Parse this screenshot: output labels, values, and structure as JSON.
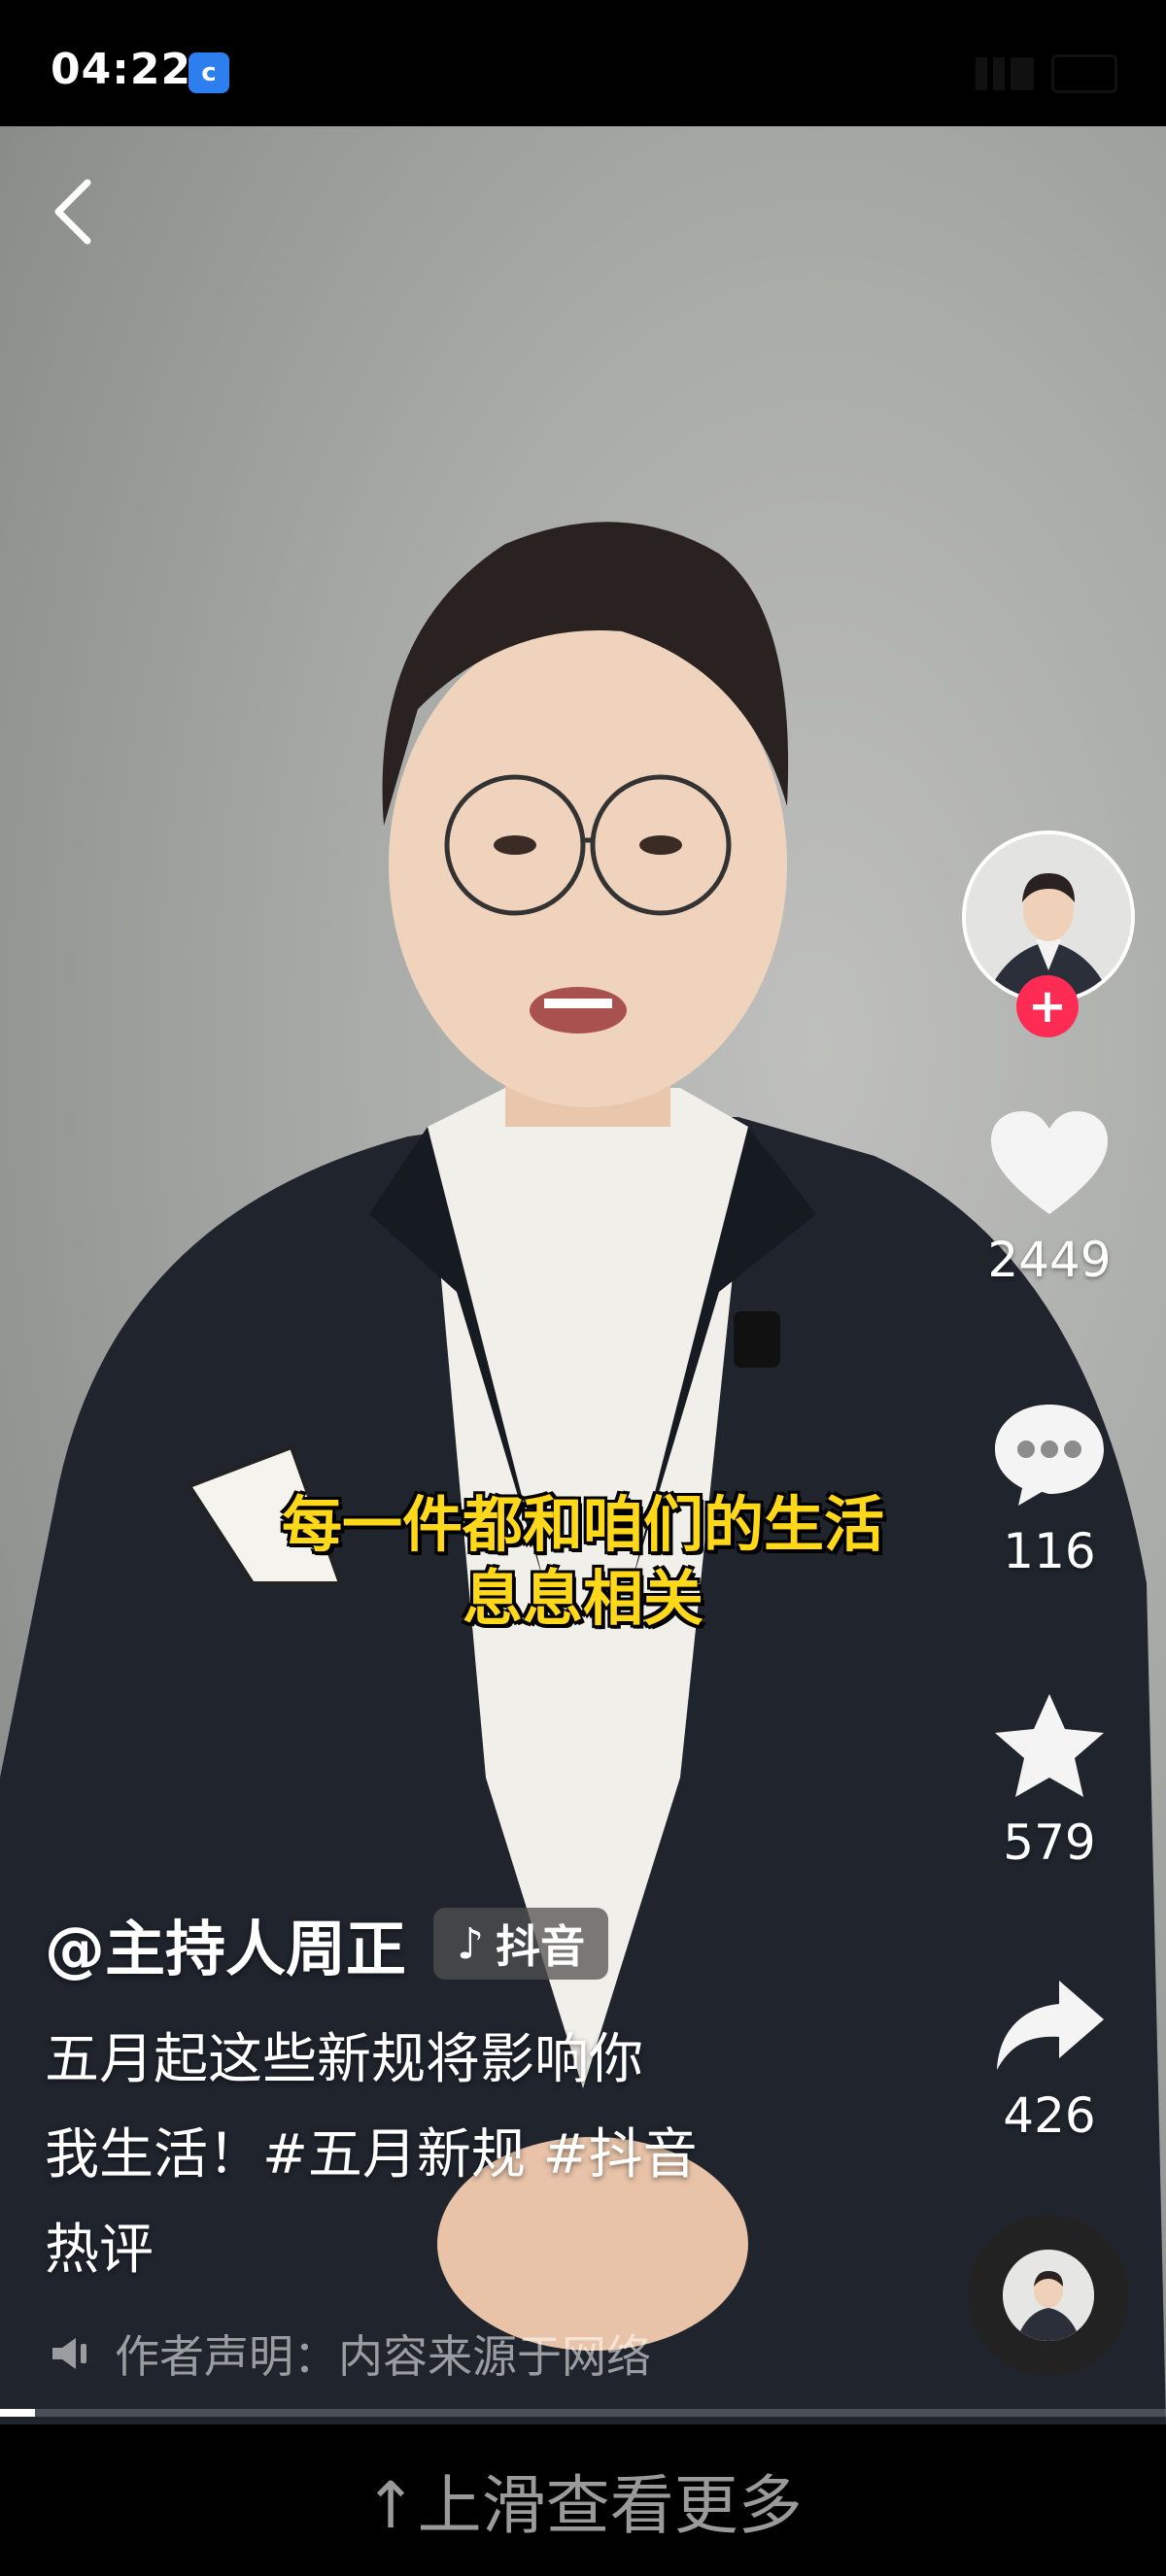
{
  "status": {
    "time": "04:22",
    "app_icon": "c"
  },
  "video": {
    "subtitle_line1": "每一件都和咱们的生活",
    "subtitle_line2": "息息相关"
  },
  "author": {
    "handle": "@主持人周正",
    "platform_tag": "抖音"
  },
  "description": {
    "line1": "五月起这些新规将影响你",
    "line2": "我生活！#五月新规 #抖音",
    "line3": "热评"
  },
  "declaration": "作者声明：内容来源于网络",
  "actions": {
    "likes": "2449",
    "comments": "116",
    "favorites": "579",
    "shares": "426"
  },
  "bottom": {
    "swipe_hint": "↑上滑查看更多"
  },
  "icons": [
    "back-icon",
    "heart-icon",
    "comment-icon",
    "star-icon",
    "share-icon",
    "speaker-icon",
    "plus-icon",
    "music-disc-icon"
  ],
  "colors": {
    "follow": "#fe2c55",
    "subtitle": "#ffd81a"
  },
  "playback_progress": 0.03
}
